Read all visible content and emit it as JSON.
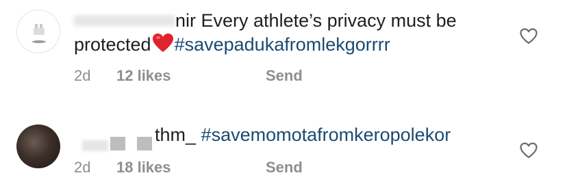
{
  "comments": [
    {
      "username": "nir",
      "text_line1": " Every athlete’s privacy must be",
      "text_line2": "protected",
      "emoji": "❤️",
      "hashtag": "#savepadukafromlekgorrrr",
      "time": "2d",
      "likes": "12 likes",
      "send": "Send"
    },
    {
      "username": "thm_",
      "hashtag": "#savemomotafromkeropolekor",
      "time": "2d",
      "likes": "18 likes",
      "send": "Send"
    }
  ],
  "icons": {
    "like": "heart-outline-icon",
    "emoji": "red-heart-emoji"
  },
  "colors": {
    "hashtag": "#1b4a72",
    "meta": "#8e8e8e",
    "emoji_heart": "#e0242c"
  }
}
